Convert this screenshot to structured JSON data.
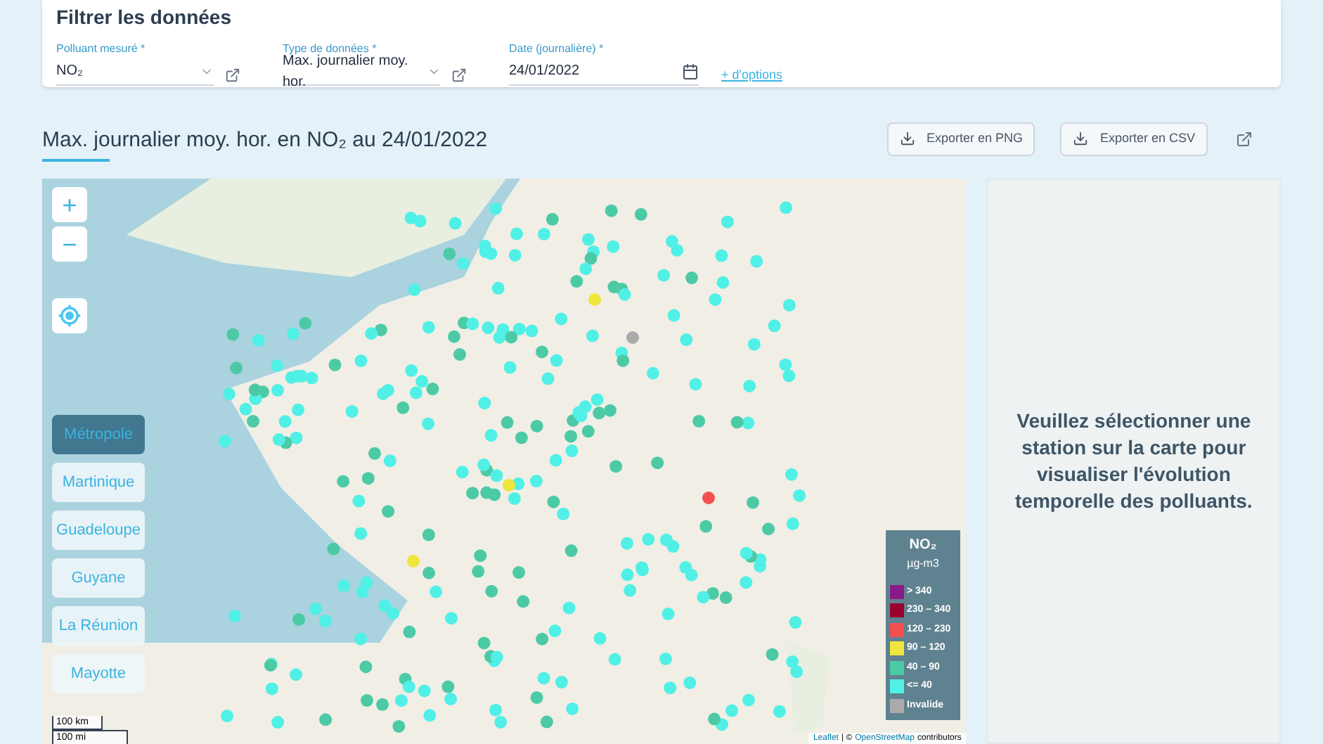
{
  "filter_panel": {
    "title": "Filtrer les données",
    "fields": [
      {
        "kind": "select",
        "label": "Polluant mesuré *",
        "value": "NO₂"
      },
      {
        "kind": "select",
        "label": "Type de données *",
        "value": "Max. journalier moy. hor."
      },
      {
        "kind": "date",
        "label": "Date (journalière) *",
        "value": "24/01/2022"
      }
    ],
    "more_options_link": "+ d'options"
  },
  "map_title": "Max. journalier moy. hor. en NO₂ au 24/01/2022",
  "export_buttons": [
    "Exporter en PNG",
    "Exporter en CSV"
  ],
  "map": {
    "zoom_in": "+",
    "zoom_out": "−",
    "regions": [
      {
        "label": "Métropole",
        "selected": true
      },
      {
        "label": "Martinique",
        "selected": false
      },
      {
        "label": "Guadeloupe",
        "selected": false
      },
      {
        "label": "Guyane",
        "selected": false
      },
      {
        "label": "La Réunion",
        "selected": false
      },
      {
        "label": "Mayotte",
        "selected": false
      }
    ],
    "scale": [
      "100 km",
      "100 mi"
    ],
    "legend": {
      "title": "NO₂",
      "unit": "µg-m3",
      "items": [
        {
          "label": "> 340",
          "color": "#8b1a89"
        },
        {
          "label": "230 – 340",
          "color": "#99002e"
        },
        {
          "label": "120 – 230",
          "color": "#f44f4f"
        },
        {
          "label": "90 – 120",
          "color": "#efe63b"
        },
        {
          "label": "40 – 90",
          "color": "#4ccaa6"
        },
        {
          "label": "<= 40",
          "color": "#50f0e6"
        },
        {
          "label": "Invalide",
          "color": "#aaaaaa"
        }
      ]
    },
    "attribution": {
      "leaflet": "Leaflet",
      "separator": "| ©",
      "osm": "OpenStreetMap",
      "suffix": "contributors"
    }
  },
  "side_panel": {
    "message": "Veuillez sélectionner une station sur la carte pour visualiser l'évolution temporelle des polluants."
  }
}
